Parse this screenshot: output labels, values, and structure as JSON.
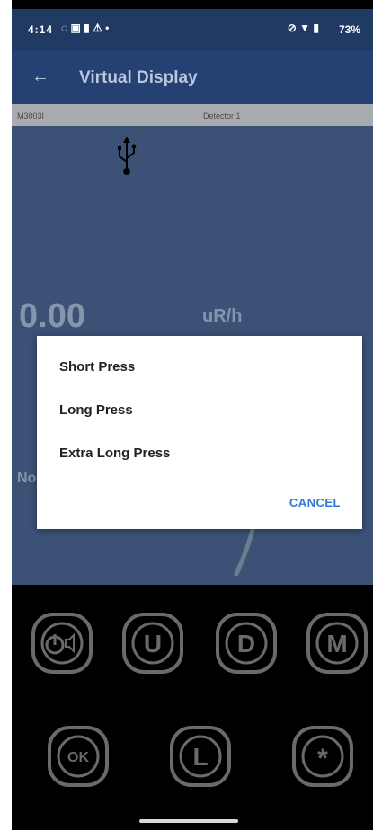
{
  "status": {
    "time": "4:14",
    "battery": "73%"
  },
  "appbar": {
    "title": "Virtual Display"
  },
  "device": {
    "model": "M3003I",
    "detector": "Detector 1"
  },
  "display": {
    "reading": "0.00",
    "unit": "uR/h",
    "partial_text": "No"
  },
  "dialog": {
    "options": [
      "Short Press",
      "Long Press",
      "Extra Long Press"
    ],
    "cancel_label": "CANCEL"
  },
  "buttons": {
    "row1": [
      "power-mute",
      "U",
      "D",
      "M"
    ],
    "row2": [
      "OK",
      "L",
      "*"
    ]
  },
  "colors": {
    "accent": "#2f7ad8",
    "appbar": "#3e6cc0",
    "statusbar": "#203a63",
    "background": "#3b5276"
  }
}
